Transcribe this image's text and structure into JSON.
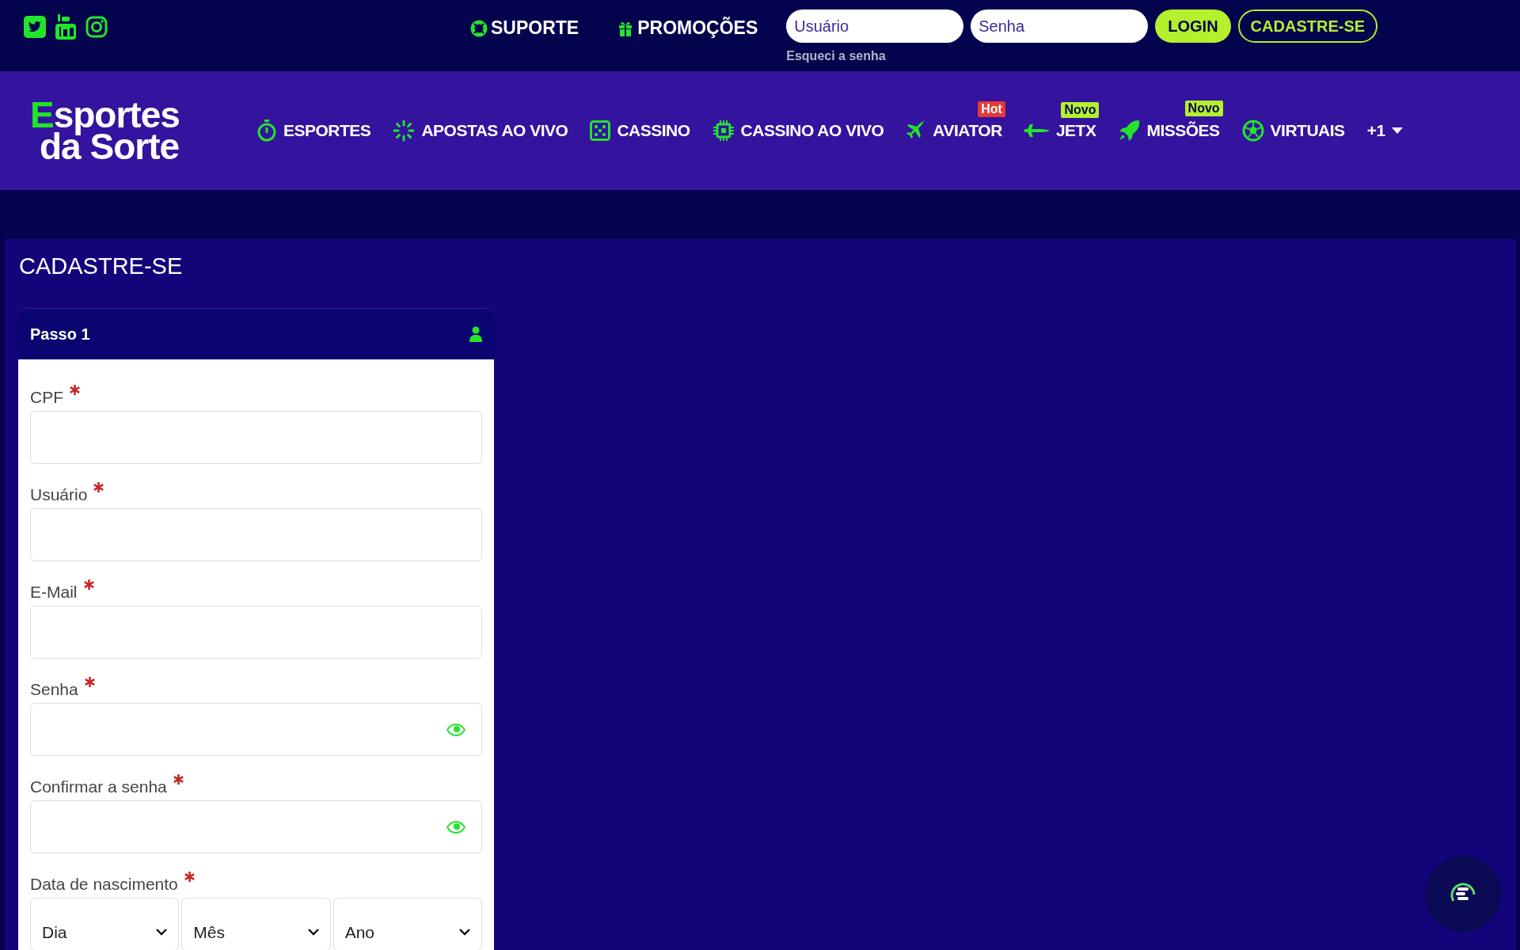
{
  "top_bar": {
    "links": [
      {
        "label": "SUPORTE"
      },
      {
        "label": "PROMOÇÕES"
      }
    ],
    "login": {
      "user_placeholder": "Usuário",
      "password_placeholder": "Senha",
      "forgot": "Esqueci a senha"
    },
    "buttons": [
      {
        "label": "LOGIN",
        "kind": "primary"
      },
      {
        "label": "CADASTRE-SE",
        "kind": "outline"
      }
    ]
  },
  "logo": {
    "line_1": "Esportes",
    "line_2": "da Sorte"
  },
  "nav": {
    "items": [
      {
        "label": "ESPORTES"
      },
      {
        "label": "APOSTAS AO VIVO"
      },
      {
        "label": "CASSINO"
      },
      {
        "label": "CASSINO AO VIVO"
      },
      {
        "label": "AVIATOR",
        "badge": {
          "text": "Hot",
          "color": "#e53935"
        }
      },
      {
        "label": "JETX",
        "badge": {
          "text": "Novo",
          "color": "#b4f02c"
        }
      },
      {
        "label": "MISSÕES",
        "badge": {
          "text": "Novo",
          "color": "#b4f02c"
        }
      },
      {
        "label": "VIRTUAIS"
      }
    ],
    "more": "+1"
  },
  "page": {
    "title": "CADASTRE-SE",
    "step": {
      "title": "Passo 1",
      "fields": [
        {
          "label": "CPF",
          "required": true,
          "kind": "text"
        },
        {
          "label": "Usuário",
          "required": true,
          "kind": "text"
        },
        {
          "label": "E-Mail",
          "required": true,
          "kind": "text"
        },
        {
          "label": "Senha",
          "required": true,
          "kind": "password"
        },
        {
          "label": "Confirmar a senha",
          "required": true,
          "kind": "password"
        },
        {
          "label": "Data de nascimento",
          "required": true,
          "kind": "date",
          "selects": [
            "Dia",
            "Mês",
            "Ano"
          ]
        }
      ]
    }
  }
}
